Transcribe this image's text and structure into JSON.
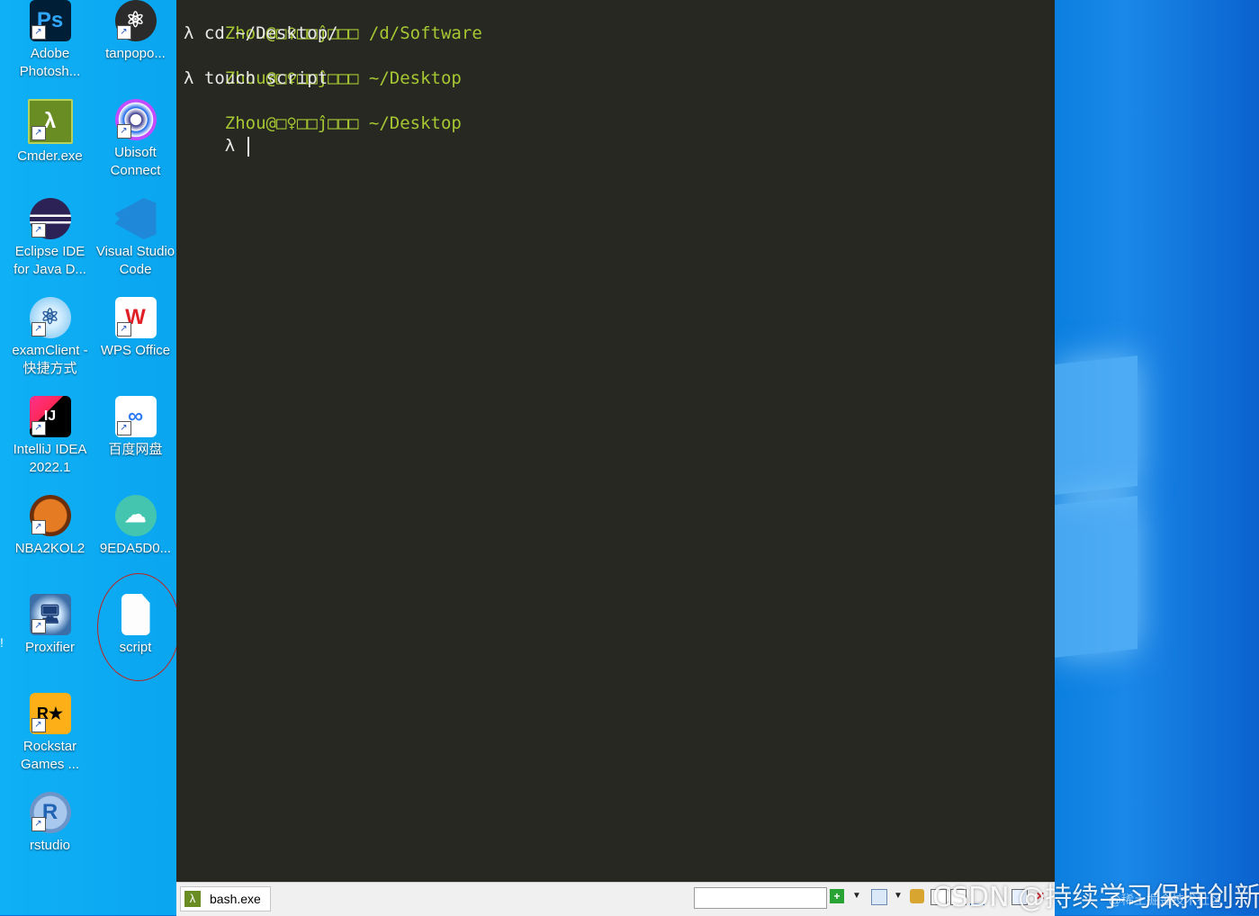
{
  "desktop": {
    "icons": [
      {
        "label": "Adobe Photosh...",
        "icon": "photoshop-icon",
        "glyph": "Ps"
      },
      {
        "label": "tanpopo...",
        "icon": "tanpopo-atom-icon",
        "glyph": "⚛"
      },
      {
        "label": "Cmder.exe",
        "icon": "cmder-lambda-icon",
        "glyph": "λ"
      },
      {
        "label": "Ubisoft Connect",
        "icon": "ubisoft-icon",
        "glyph": ""
      },
      {
        "label": "Eclipse IDE for Java D...",
        "icon": "eclipse-icon",
        "glyph": ""
      },
      {
        "label": "Visual Studio Code",
        "icon": "vscode-icon",
        "glyph": ""
      },
      {
        "label": "examClient - 快捷方式",
        "icon": "exam-client-icon",
        "glyph": "⚛"
      },
      {
        "label": "WPS Office",
        "icon": "wps-office-icon",
        "glyph": "W"
      },
      {
        "label": "IntelliJ IDEA 2022.1",
        "icon": "intellij-icon",
        "glyph": "IJ"
      },
      {
        "label": "百度网盘",
        "icon": "baidu-netdisk-icon",
        "glyph": "∞"
      },
      {
        "label": "NBA2KOL2",
        "icon": "basketball-icon",
        "glyph": ""
      },
      {
        "label": "9EDA5D0...",
        "icon": "cloud-app-icon",
        "glyph": "☁"
      },
      {
        "label": "Proxifier",
        "icon": "proxifier-icon",
        "glyph": "🖥"
      },
      {
        "label": "script",
        "icon": "blank-file-icon",
        "glyph": ""
      },
      {
        "label": "Rockstar Games ...",
        "icon": "rockstar-icon",
        "glyph": "R★"
      },
      {
        "label": "rstudio",
        "icon": "rstudio-icon",
        "glyph": "R"
      }
    ],
    "edge_label": "!"
  },
  "terminal": {
    "lines": [
      {
        "type": "prompt",
        "user": "Zhou@□♀□□ĵ□□□",
        "path": " /d/Software"
      },
      {
        "type": "cmd",
        "text": "λ cd ~/Desktop/"
      },
      {
        "type": "prompt",
        "user": "Zhou@□♀□□ĵ□□□",
        "path": " ~/Desktop"
      },
      {
        "type": "cmd",
        "text": "λ touch script"
      },
      {
        "type": "prompt",
        "user": "Zhou@□♀□□ĵ□□□",
        "path": " ~/Desktop"
      },
      {
        "type": "cmd",
        "text": "λ "
      }
    ]
  },
  "statusbar": {
    "tab_label": "bash.exe",
    "tab_icon": "λ",
    "search_value": ""
  },
  "watermark": {
    "main": "CSDN @持续学习保持创新",
    "sub": "@稀土掘金技术社区"
  }
}
